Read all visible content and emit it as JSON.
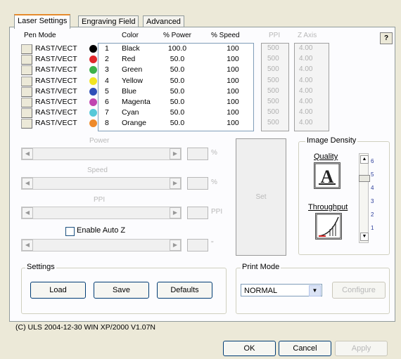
{
  "tabs": [
    "Laser Settings",
    "Engraving Field",
    "Advanced"
  ],
  "help_label": "?",
  "headers": {
    "pen_mode": "Pen Mode",
    "color": "Color",
    "power": "% Power",
    "speed": "% Speed",
    "ppi": "PPI",
    "z_axis": "Z Axis"
  },
  "pens": [
    {
      "mode": "RAST/VECT",
      "num": "1",
      "color": "Black",
      "dot": "#000000",
      "power": "100.0",
      "speed": "100",
      "ppi": "500",
      "z": "4.00"
    },
    {
      "mode": "RAST/VECT",
      "num": "2",
      "color": "Red",
      "dot": "#e0262b",
      "power": "50.0",
      "speed": "100",
      "ppi": "500",
      "z": "4.00"
    },
    {
      "mode": "RAST/VECT",
      "num": "3",
      "color": "Green",
      "dot": "#3cb14a",
      "power": "50.0",
      "speed": "100",
      "ppi": "500",
      "z": "4.00"
    },
    {
      "mode": "RAST/VECT",
      "num": "4",
      "color": "Yellow",
      "dot": "#f1e424",
      "power": "50.0",
      "speed": "100",
      "ppi": "500",
      "z": "4.00"
    },
    {
      "mode": "RAST/VECT",
      "num": "5",
      "color": "Blue",
      "dot": "#2f4fb8",
      "power": "50.0",
      "speed": "100",
      "ppi": "500",
      "z": "4.00"
    },
    {
      "mode": "RAST/VECT",
      "num": "6",
      "color": "Magenta",
      "dot": "#c045b0",
      "power": "50.0",
      "speed": "100",
      "ppi": "500",
      "z": "4.00"
    },
    {
      "mode": "RAST/VECT",
      "num": "7",
      "color": "Cyan",
      "dot": "#55c8d8",
      "power": "50.0",
      "speed": "100",
      "ppi": "500",
      "z": "4.00"
    },
    {
      "mode": "RAST/VECT",
      "num": "8",
      "color": "Orange",
      "dot": "#ee8a2a",
      "power": "50.0",
      "speed": "100",
      "ppi": "500",
      "z": "4.00"
    }
  ],
  "sliders": {
    "power_label": "Power",
    "power_unit": "%",
    "speed_label": "Speed",
    "speed_unit": "%",
    "ppi_label": "PPI",
    "ppi_unit": "PPI",
    "z_unit": "\""
  },
  "enable_auto_z": "Enable Auto Z",
  "go_label": "Set",
  "image_density": {
    "label": "Image Density",
    "quality": "Quality",
    "throughput": "Throughput",
    "ticks": [
      "6",
      "5",
      "4",
      "3",
      "2",
      "1"
    ],
    "selected": "5"
  },
  "settings": {
    "label": "Settings",
    "load": "Load",
    "save": "Save",
    "defaults": "Defaults"
  },
  "print_mode": {
    "label": "Print Mode",
    "value": "NORMAL",
    "configure": "Configure"
  },
  "footer_text": "(C) ULS 2004-12-30 WIN XP/2000 V1.07N",
  "dialog_buttons": {
    "ok": "OK",
    "cancel": "Cancel",
    "apply": "Apply"
  }
}
